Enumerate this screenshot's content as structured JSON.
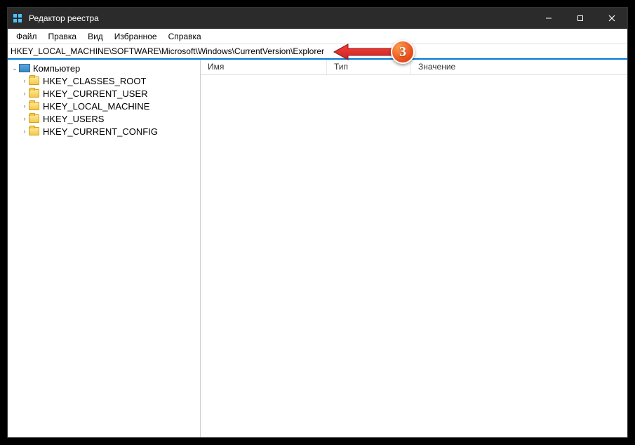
{
  "window": {
    "title": "Редактор реестра"
  },
  "menu": {
    "file": "Файл",
    "edit": "Правка",
    "view": "Вид",
    "favorites": "Избранное",
    "help": "Справка"
  },
  "address": {
    "value": "HKEY_LOCAL_MACHINE\\SOFTWARE\\Microsoft\\Windows\\CurrentVersion\\Explorer"
  },
  "tree": {
    "root": "Компьютер",
    "items": [
      "HKEY_CLASSES_ROOT",
      "HKEY_CURRENT_USER",
      "HKEY_LOCAL_MACHINE",
      "HKEY_USERS",
      "HKEY_CURRENT_CONFIG"
    ]
  },
  "columns": {
    "name": "Имя",
    "type": "Тип",
    "value": "Значение"
  },
  "annotation": {
    "step": "3"
  }
}
